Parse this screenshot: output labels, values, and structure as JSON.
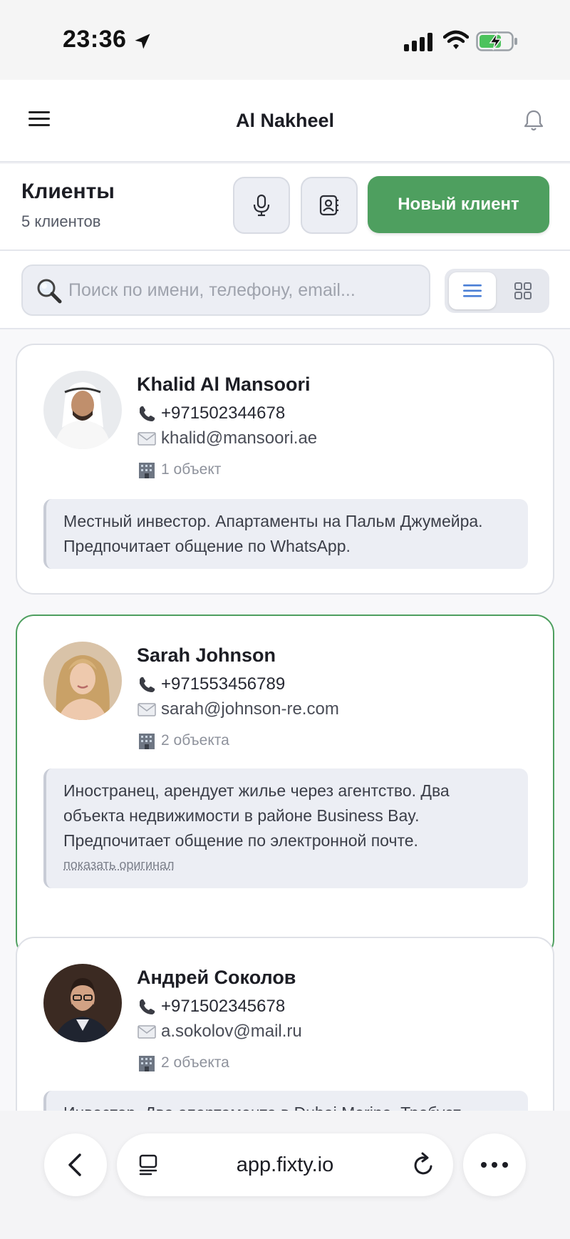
{
  "status_bar": {
    "time": "23:36"
  },
  "header": {
    "title": "Al Nakheel"
  },
  "clients_bar": {
    "title": "Клиенты",
    "count": "5 клиентов",
    "new_client_label": "Новый клиент"
  },
  "search": {
    "placeholder": "Поиск по имени, телефону, email..."
  },
  "clients": [
    {
      "name": "Khalid Al Mansoori",
      "phone": "+971502344678",
      "email": "khalid@mansoori.ae",
      "objects": "1 объект",
      "note": "Местный инвестор. Апартаменты на Пальм Джумейра. Предпочитает общение по WhatsApp."
    },
    {
      "name": "Sarah Johnson",
      "phone": "+971553456789",
      "email": "sarah@johnson-re.com",
      "objects": "2 объекта",
      "note": "Иностранец, арендует жилье через агентство. Два объекта недвижимости в районе Business Bay. Предпочитает общение по электронной почте.",
      "show_original": "показать оригинал"
    },
    {
      "name": "Андрей Соколов",
      "phone": "+971502345678",
      "email": "a.sokolov@mail.ru",
      "objects": "2 объекта",
      "note": "Инвестор. Два апартамента в Dubai Marina. Требует"
    }
  ],
  "browser": {
    "url": "app.fixty.io"
  },
  "colors": {
    "accent_green": "#4e9f5f",
    "card_border": "#dfe1e7",
    "list_view_blue": "#4a7fd6"
  }
}
